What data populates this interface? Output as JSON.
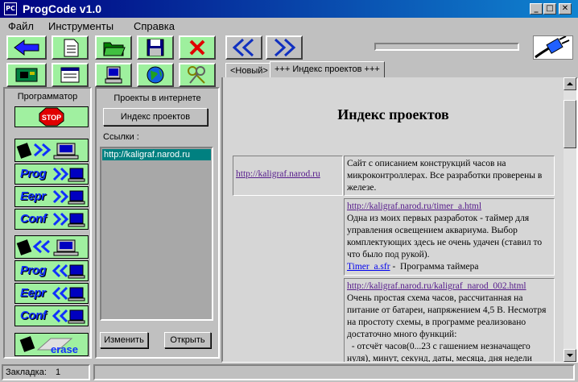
{
  "window": {
    "title": "ProgCode v1.0",
    "icon_text": "PC"
  },
  "menu": {
    "items": [
      "Файл",
      "Инструменты",
      "Справка"
    ]
  },
  "left_panel": {
    "title": "Программатор",
    "erase_label": "erase"
  },
  "prog_buttons": [
    {
      "label": "Prog"
    },
    {
      "label": "Eepr"
    },
    {
      "label": "Conf"
    },
    {
      "label": "Prog"
    },
    {
      "label": "Eepr"
    },
    {
      "label": "Conf"
    }
  ],
  "mid_panel": {
    "title": "Проекты в интернете",
    "index_button": "Индекс проектов",
    "links_label": "Ссылки :",
    "links": [
      "http://kaligraf.narod.ru"
    ],
    "edit_button": "Изменить",
    "open_button": "Открыть"
  },
  "tabs": [
    "<Новый>",
    "+++ Индекс проектов +++"
  ],
  "document": {
    "title": "Индекс проектов",
    "row1": {
      "link": "http://kaligraf.narod.ru",
      "text": "Сайт с описанием конструкций часов на микроконтроллерах. Все разработки проверены в железе."
    },
    "row2": {
      "link": "http://kaligraf.narod.ru/timer_a.html",
      "text": "Одна из моих первых разработок - таймер для управления освещением аквариума. Выбор комплектующих здесь не очень удачен (ставил то что было под рукой).",
      "file_link": "Timer_a.sfr",
      "file_text": " -  Программа таймера"
    },
    "row3": {
      "link": "http://kaligraf.narod.ru/kaligraf_narod_002.html",
      "text": "Очень простая схема часов, рассчитанная на питание от батареи, напряжением 4,5 В. Несмотря на простоту схемы, в программе реализовано достаточно много функций:",
      "item1": "  - отсчёт часов(0...23 с гашением незначащего",
      "item2": "нуля), минут, секунд, даты, месяца, дня недели"
    }
  },
  "status": {
    "label": "Закладка:",
    "value": "1"
  },
  "colors": {
    "title_start": "#000080",
    "title_end": "#1084d0",
    "button_green": "#a0f0a0",
    "link_selected": "#008080"
  }
}
